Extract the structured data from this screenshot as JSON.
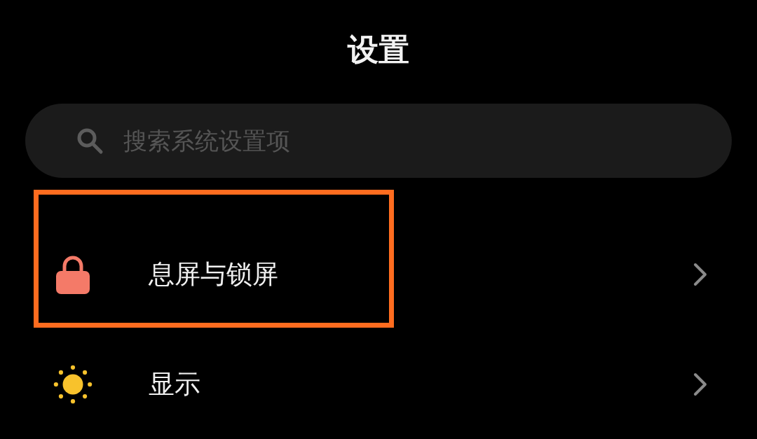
{
  "title": "设置",
  "search": {
    "placeholder": "搜索系统设置项"
  },
  "items": [
    {
      "kind": "lock",
      "label": "息屏与锁屏",
      "highlighted": true
    },
    {
      "kind": "sun",
      "label": "显示",
      "highlighted": false
    }
  ]
}
